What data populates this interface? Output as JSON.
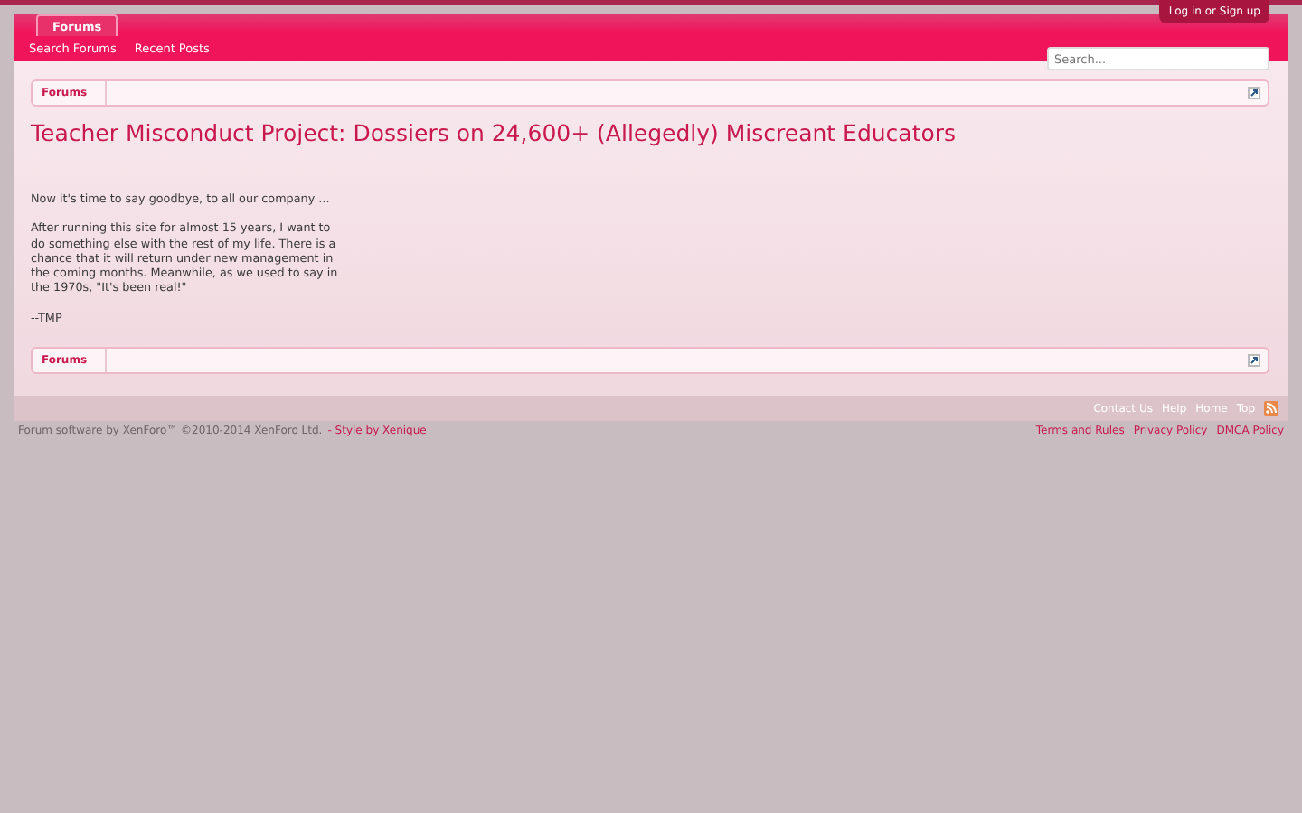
{
  "header": {
    "login": "Log in or Sign up",
    "tabs": [
      {
        "label": "Forums",
        "selected": true
      }
    ],
    "subnav": [
      "Search Forums",
      "Recent Posts"
    ],
    "search": {
      "placeholder": "Search..."
    }
  },
  "breadcrumb_top": {
    "items": [
      "Forums"
    ]
  },
  "title": "Teacher Misconduct Project: Dossiers on 24,600+ (Allegedly) Miscreant Educators",
  "paragraphs": [
    "Now it's time to say goodbye, to all our company ...",
    "After running this site for almost 15 years, I want to do something else with the rest of my life. There is a chance that it will return under new management in the coming months. Meanwhile, as we used to say in the 1970s, \"It's been real!\"",
    "--TMP"
  ],
  "breadcrumb_bottom": {
    "items": [
      "Forums"
    ]
  },
  "footer_links": [
    "Contact Us",
    "Help",
    "Home",
    "Top"
  ],
  "copyright": "Forum software by XenForo™ ©2010-2014 XenForo Ltd.",
  "style_credit": "- Style by Xenique",
  "legal_links": [
    "Terms and Rules",
    "Privacy Policy",
    "DMCA Policy"
  ]
}
